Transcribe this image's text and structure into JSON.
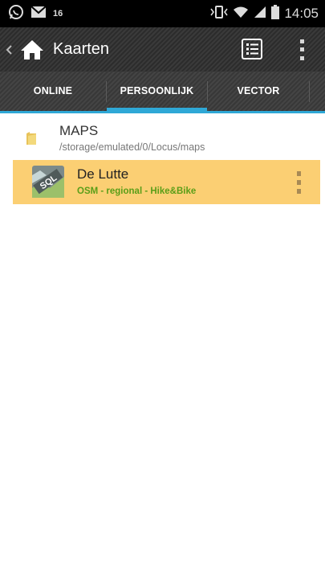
{
  "status_bar": {
    "notification_badge": "16",
    "time": "14:05",
    "icons": [
      "whatsapp-icon",
      "gmail-icon",
      "vibrate-icon",
      "wifi-icon",
      "signal-icon",
      "battery-icon"
    ]
  },
  "action_bar": {
    "title": "Kaarten",
    "icons": [
      "back-chevron-icon",
      "home-icon",
      "list-view-icon",
      "overflow-menu-icon"
    ]
  },
  "tabs": [
    {
      "label": "ONLINE",
      "active": false
    },
    {
      "label": "PERSOONLIJK",
      "active": true
    },
    {
      "label": "VECTOR",
      "active": false
    }
  ],
  "folder": {
    "name": "MAPS",
    "path": "/storage/emulated/0/Locus/maps",
    "icon": "folder-icon"
  },
  "maps": [
    {
      "title": "De Lutte",
      "subtitle": "OSM - regional - Hike&Bike",
      "icon": "sql-map-icon",
      "selected": true
    }
  ],
  "colors": {
    "tab_accent": "#2fa8d6",
    "selected_row": "#fbcf73",
    "subtitle_green": "#5a9e18",
    "status_bar": "#000000"
  }
}
